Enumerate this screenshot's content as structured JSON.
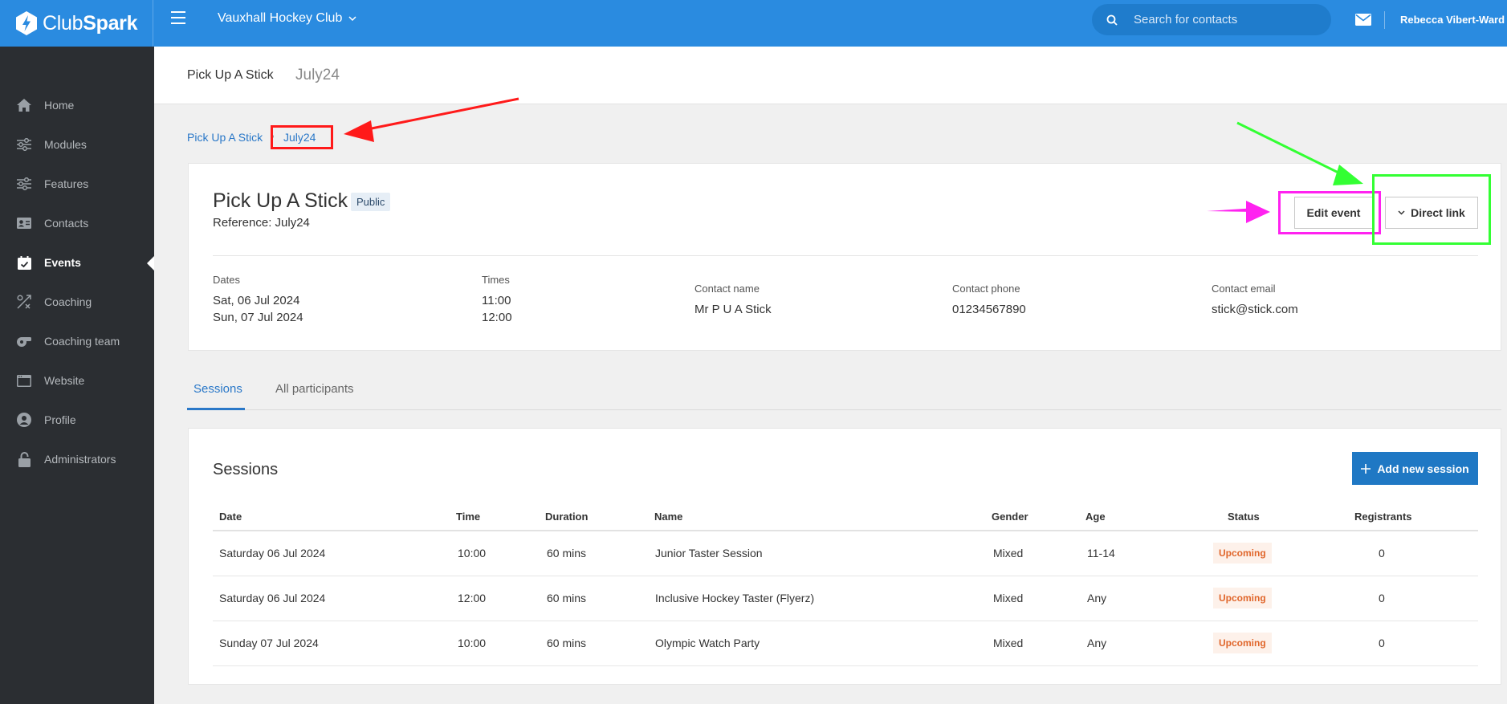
{
  "topbar": {
    "logo_club": "Club",
    "logo_spark": "Spark",
    "club_name": "Vauxhall Hockey Club",
    "search_placeholder": "Search for contacts",
    "user_name": "Rebecca Vibert-Ward"
  },
  "sidebar": {
    "items": [
      {
        "label": "Home",
        "icon": "home-icon"
      },
      {
        "label": "Modules",
        "icon": "sliders-icon"
      },
      {
        "label": "Features",
        "icon": "sliders-icon"
      },
      {
        "label": "Contacts",
        "icon": "contact-card-icon"
      },
      {
        "label": "Events",
        "icon": "calendar-check-icon",
        "active": true
      },
      {
        "label": "Coaching",
        "icon": "coaching-icon"
      },
      {
        "label": "Coaching team",
        "icon": "whistle-icon"
      },
      {
        "label": "Website",
        "icon": "browser-icon"
      },
      {
        "label": "Profile",
        "icon": "user-circle-icon"
      },
      {
        "label": "Administrators",
        "icon": "lock-icon"
      }
    ]
  },
  "page_header": {
    "title": "Pick Up A Stick",
    "subtitle": "July24"
  },
  "breadcrumb": {
    "parent": "Pick Up A Stick",
    "current": "July24"
  },
  "event": {
    "title": "Pick Up A Stick",
    "badge": "Public",
    "reference": "Reference: July24",
    "edit_label": "Edit event",
    "link_label": "Direct link",
    "dates_label": "Dates",
    "dates": [
      "Sat, 06 Jul 2024",
      "Sun, 07 Jul 2024"
    ],
    "times_label": "Times",
    "times": [
      "11:00",
      "12:00"
    ],
    "contact_name_label": "Contact name",
    "contact_name": "Mr P U A Stick",
    "contact_phone_label": "Contact phone",
    "contact_phone": "01234567890",
    "contact_email_label": "Contact email",
    "contact_email": "stick@stick.com"
  },
  "tabs": {
    "sessions": "Sessions",
    "all_participants": "All participants"
  },
  "sessions": {
    "title": "Sessions",
    "add_label": "Add new session",
    "headers": {
      "date": "Date",
      "time": "Time",
      "duration": "Duration",
      "name": "Name",
      "gender": "Gender",
      "age": "Age",
      "status": "Status",
      "registrants": "Registrants"
    },
    "rows": [
      {
        "date": "Saturday 06 Jul 2024",
        "time": "10:00",
        "duration": "60 mins",
        "name": "Junior Taster Session",
        "gender": "Mixed",
        "age": "11-14",
        "status": "Upcoming",
        "registrants": "0"
      },
      {
        "date": "Saturday 06 Jul 2024",
        "time": "12:00",
        "duration": "60 mins",
        "name": "Inclusive Hockey Taster (Flyerz)",
        "gender": "Mixed",
        "age": "Any",
        "status": "Upcoming",
        "registrants": "0"
      },
      {
        "date": "Sunday 07 Jul 2024",
        "time": "10:00",
        "duration": "60 mins",
        "name": "Olympic Watch Party",
        "gender": "Mixed",
        "age": "Any",
        "status": "Upcoming",
        "registrants": "0"
      }
    ]
  },
  "colors": {
    "topbar": "#2a8be0",
    "sidebar": "#2b2e32",
    "accent": "#1f78c4",
    "status_upcoming": "#e0662b",
    "annotation_red": "#ff1a1a",
    "annotation_magenta": "#ff22f0",
    "annotation_green": "#33ff33"
  }
}
